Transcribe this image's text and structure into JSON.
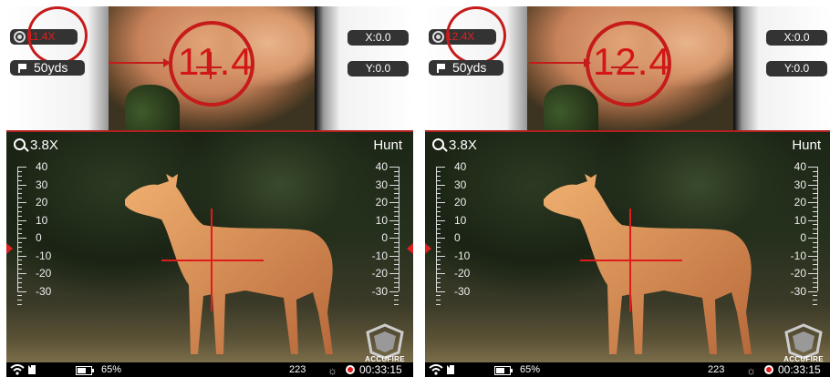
{
  "panels": [
    {
      "zoom_magnification": "11.4X",
      "distance": "50yds",
      "offset_x": "X:0.0",
      "offset_y": "Y:0.0",
      "zoom_reading": "11.4",
      "magnification": "3.8X",
      "mode": "Hunt",
      "scale_labels": [
        "40",
        "30",
        "20",
        "10",
        "0",
        "-10",
        "-20",
        "-30"
      ],
      "logo_text": "ACCUFIRE",
      "battery": "65%",
      "counter": "223",
      "rec_time": "00:33:15"
    },
    {
      "zoom_magnification": "12.4X",
      "distance": "50yds",
      "offset_x": "X:0.0",
      "offset_y": "Y:0.0",
      "zoom_reading": "12.4",
      "magnification": "3.8X",
      "mode": "Hunt",
      "scale_labels": [
        "40",
        "30",
        "20",
        "10",
        "0",
        "-10",
        "-20",
        "-30"
      ],
      "logo_text": "ACCUFIRE",
      "battery": "65%",
      "counter": "223",
      "rec_time": "00:33:15"
    }
  ],
  "colors": {
    "reticle": "#e01b1b",
    "pill_bg": "#333333",
    "status_bg": "#000000"
  },
  "icons": [
    "gear-icon",
    "flag-icon",
    "search-icon",
    "wifi-icon",
    "sd-card-icon",
    "battery-icon",
    "brightness-icon",
    "record-icon"
  ]
}
